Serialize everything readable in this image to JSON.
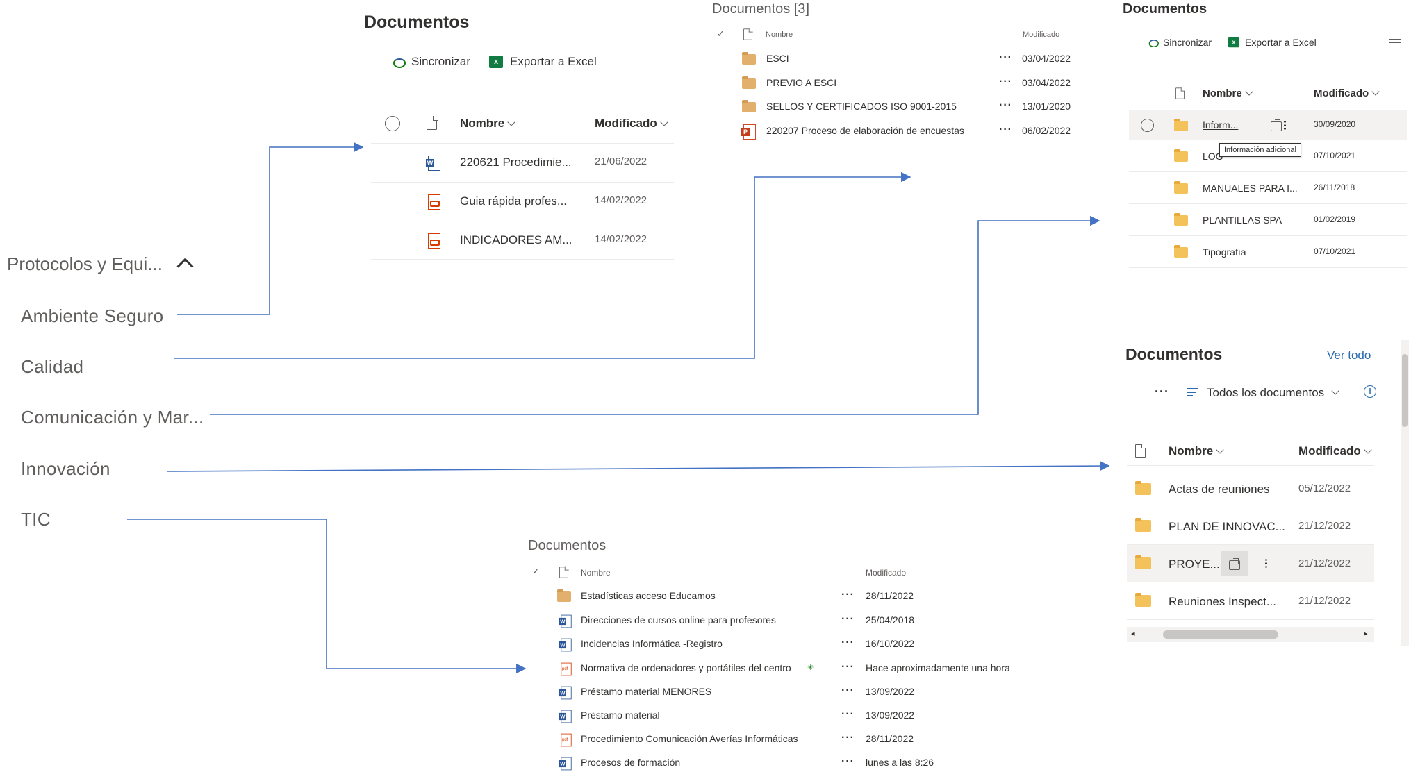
{
  "nav": {
    "parent": "Protocolos y Equi...",
    "items": [
      "Ambiente Seguro",
      "Calidad",
      "Comunicación y Mar...",
      "Innovación",
      "TIC"
    ]
  },
  "panel_ambiente": {
    "title": "Documentos",
    "sync_label": "Sincronizar",
    "export_label": "Exportar a Excel",
    "col_name": "Nombre",
    "col_modified": "Modificado",
    "rows": [
      {
        "icon": "word-icon",
        "name": "220621 Procedimie...",
        "modified": "21/06/2022"
      },
      {
        "icon": "pdf-icon",
        "name": "Guia rápida profes...",
        "modified": "14/02/2022"
      },
      {
        "icon": "pdf-icon",
        "name": "INDICADORES AM...",
        "modified": "14/02/2022"
      }
    ]
  },
  "panel_calidad": {
    "title": "Documentos [3]",
    "col_name": "Nombre",
    "col_modified": "Modificado",
    "rows": [
      {
        "icon": "folder-icon",
        "name": "ESCI",
        "more": "···",
        "modified": "03/04/2022"
      },
      {
        "icon": "folder-icon",
        "name": "PREVIO A ESCI",
        "more": "···",
        "modified": "03/04/2022"
      },
      {
        "icon": "folder-icon",
        "name": "SELLOS Y CERTIFICADOS ISO 9001-2015",
        "more": "···",
        "modified": "13/01/2020"
      },
      {
        "icon": "pptx-icon",
        "name": "220207 Proceso de elaboración de encuestas",
        "more": "···",
        "modified": "06/02/2022"
      }
    ]
  },
  "panel_comunicacion": {
    "title": "Documentos",
    "sync_label": "Sincronizar",
    "export_label": "Exportar a Excel",
    "col_name": "Nombre",
    "col_modified": "Modificado",
    "tooltip": "Información adicional",
    "rows": [
      {
        "icon": "folder-icon",
        "name": "Inform...",
        "modified": "30/09/2020"
      },
      {
        "icon": "folder-icon",
        "name": "LOG",
        "modified": "07/10/2021"
      },
      {
        "icon": "folder-icon",
        "name": "MANUALES PARA I...",
        "modified": "26/11/2018"
      },
      {
        "icon": "folder-icon",
        "name": "PLANTILLAS SPA",
        "modified": "01/02/2019"
      },
      {
        "icon": "folder-icon",
        "name": "Tipografía",
        "modified": "07/10/2021"
      }
    ]
  },
  "panel_innovacion": {
    "title": "Documentos",
    "see_all": "Ver todo",
    "more": "···",
    "view_label": "Todos los documentos",
    "col_name": "Nombre",
    "col_modified": "Modificado",
    "rows": [
      {
        "icon": "folder-icon",
        "name": "Actas de reuniones",
        "modified": "05/12/2022"
      },
      {
        "icon": "folder-icon",
        "name": "PLAN DE INNOVAC...",
        "modified": "21/12/2022"
      },
      {
        "icon": "folder-icon",
        "name": "PROYE...",
        "modified": "21/12/2022"
      },
      {
        "icon": "folder-icon",
        "name": "Reuniones  Inspect...",
        "modified": "21/12/2022"
      }
    ]
  },
  "panel_tic": {
    "title": "Documentos",
    "col_name": "Nombre",
    "col_modified": "Modificado",
    "rows": [
      {
        "icon": "folder-icon",
        "name": "Estadísticas acceso Educamos",
        "more": "···",
        "modified": "28/11/2022"
      },
      {
        "icon": "word-icon",
        "name": "Direcciones de cursos online para profesores",
        "more": "···",
        "modified": "25/04/2018"
      },
      {
        "icon": "word-icon",
        "name": "Incidencias Informática -Registro",
        "more": "···",
        "modified": "16/10/2022"
      },
      {
        "icon": "pdf-icon",
        "name": "Normativa de ordenadores y portátiles del centro",
        "more": "···",
        "modified": "Hace aproximadamente una hora"
      },
      {
        "icon": "word-icon",
        "name": "Préstamo material MENORES",
        "more": "···",
        "modified": "13/09/2022"
      },
      {
        "icon": "word-icon",
        "name": "Préstamo material",
        "more": "···",
        "modified": "13/09/2022"
      },
      {
        "icon": "pdf-icon",
        "name": "Procedimiento Comunicación Averías Informáticas",
        "more": "···",
        "modified": "28/11/2022"
      },
      {
        "icon": "word-icon",
        "name": "Procesos de formación",
        "more": "···",
        "modified": "lunes a las 8:26"
      }
    ]
  },
  "colors": {
    "arrow": "#4472c4",
    "link": "#2b6cb0",
    "folder": "#f4c25b"
  }
}
